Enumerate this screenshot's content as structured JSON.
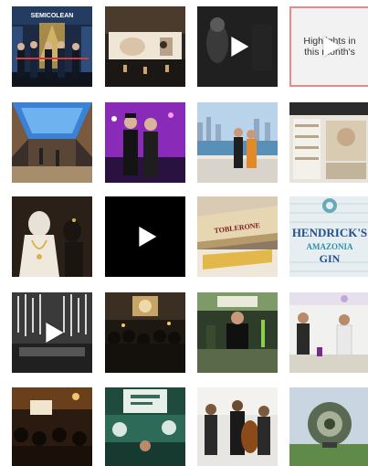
{
  "grid": {
    "tiles": [
      {
        "id": "r1c1",
        "video": false,
        "sign_text": "SEMICOLEAN"
      },
      {
        "id": "r1c2",
        "video": false
      },
      {
        "id": "r1c3",
        "video": true
      },
      {
        "id": "r1c4",
        "video": true,
        "caption": "Highlights in this month's"
      },
      {
        "id": "r2c1",
        "video": false
      },
      {
        "id": "r2c2",
        "video": false
      },
      {
        "id": "r2c3",
        "video": false
      },
      {
        "id": "r2c4",
        "video": false
      },
      {
        "id": "r3c1",
        "video": false
      },
      {
        "id": "r3c2",
        "video": true
      },
      {
        "id": "r3c3",
        "video": false,
        "sign_text": "TOBLERONE"
      },
      {
        "id": "r3c4",
        "video": false,
        "brand_line1": "HENDRICK'S",
        "brand_line2": "AMAZONIA",
        "brand_line3": "GIN"
      },
      {
        "id": "r4c1",
        "video": true
      },
      {
        "id": "r4c2",
        "video": false
      },
      {
        "id": "r4c3",
        "video": false
      },
      {
        "id": "r4c4",
        "video": false
      },
      {
        "id": "r5c1",
        "video": false
      },
      {
        "id": "r5c2",
        "video": false
      },
      {
        "id": "r5c3",
        "video": false
      },
      {
        "id": "r5c4",
        "video": false
      }
    ]
  },
  "colors": {
    "background": "#ffffff",
    "play_icon": "#ffffff",
    "highlight_tile_bg": "#f2f2f2",
    "highlight_tile_border": "#e98a8a",
    "hendricks_text": "#1f4f8f"
  }
}
